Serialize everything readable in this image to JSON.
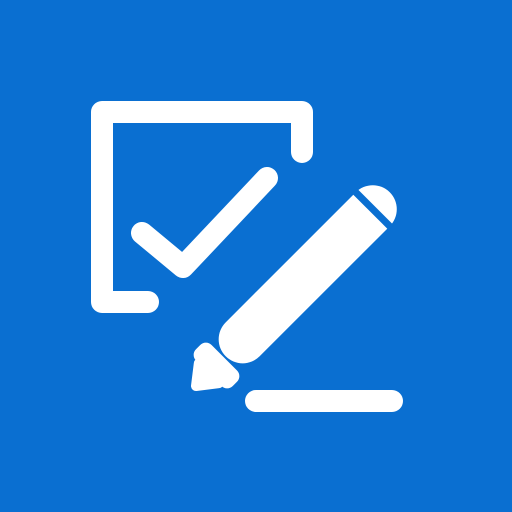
{
  "icon": {
    "name": "checklist-with-pen-icon",
    "background_color": "#0a6fd1",
    "foreground_color": "#ffffff"
  }
}
